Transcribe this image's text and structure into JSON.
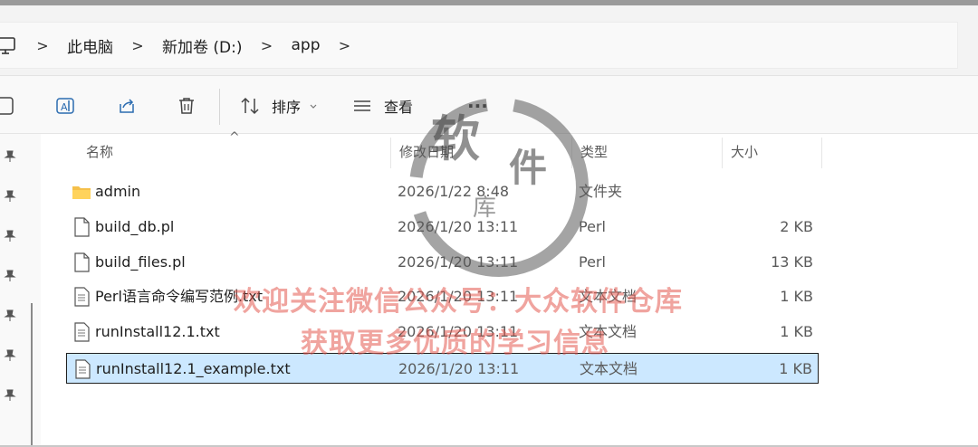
{
  "breadcrumb": {
    "items": [
      "此电脑",
      "新加卷 (D:)",
      "app"
    ],
    "separator": ">"
  },
  "toolbar": {
    "sort_label": "排序",
    "view_label": "查看",
    "more_label": "···"
  },
  "columns": {
    "name": "名称",
    "date": "修改日期",
    "type": "类型",
    "size": "大小"
  },
  "files": [
    {
      "name": "admin",
      "date": "2026/1/22 8:48",
      "type": "文件夹",
      "size": "",
      "icon": "folder-icon"
    },
    {
      "name": "build_db.pl",
      "date": "2026/1/20 13:11",
      "type": "Perl",
      "size": "2 KB",
      "icon": "file-icon"
    },
    {
      "name": "build_files.pl",
      "date": "2026/1/20 13:11",
      "type": "Perl",
      "size": "13 KB",
      "icon": "file-icon"
    },
    {
      "name": "Perl语言命令编写范例.txt",
      "date": "2026/1/20 13:11",
      "type": "文本文档",
      "size": "1 KB",
      "icon": "text-file-icon"
    },
    {
      "name": "runInstall12.1.txt",
      "date": "2026/1/20 13:11",
      "type": "文本文档",
      "size": "1 KB",
      "icon": "text-file-icon"
    },
    {
      "name": "runInstall12.1_example.txt",
      "date": "2026/1/20 13:11",
      "type": "文本文档",
      "size": "1 KB",
      "icon": "text-file-icon",
      "selected": true
    }
  ],
  "watermark": {
    "line1": "欢迎关注微信公众号：大众软件仓库",
    "line2": "获取更多优质的学习信息",
    "logo_chars": [
      "软",
      "件",
      "库"
    ]
  },
  "colors": {
    "selected_row": "#cce8ff",
    "folder": "#f5c04a",
    "watermark_text": "#e45a50"
  }
}
